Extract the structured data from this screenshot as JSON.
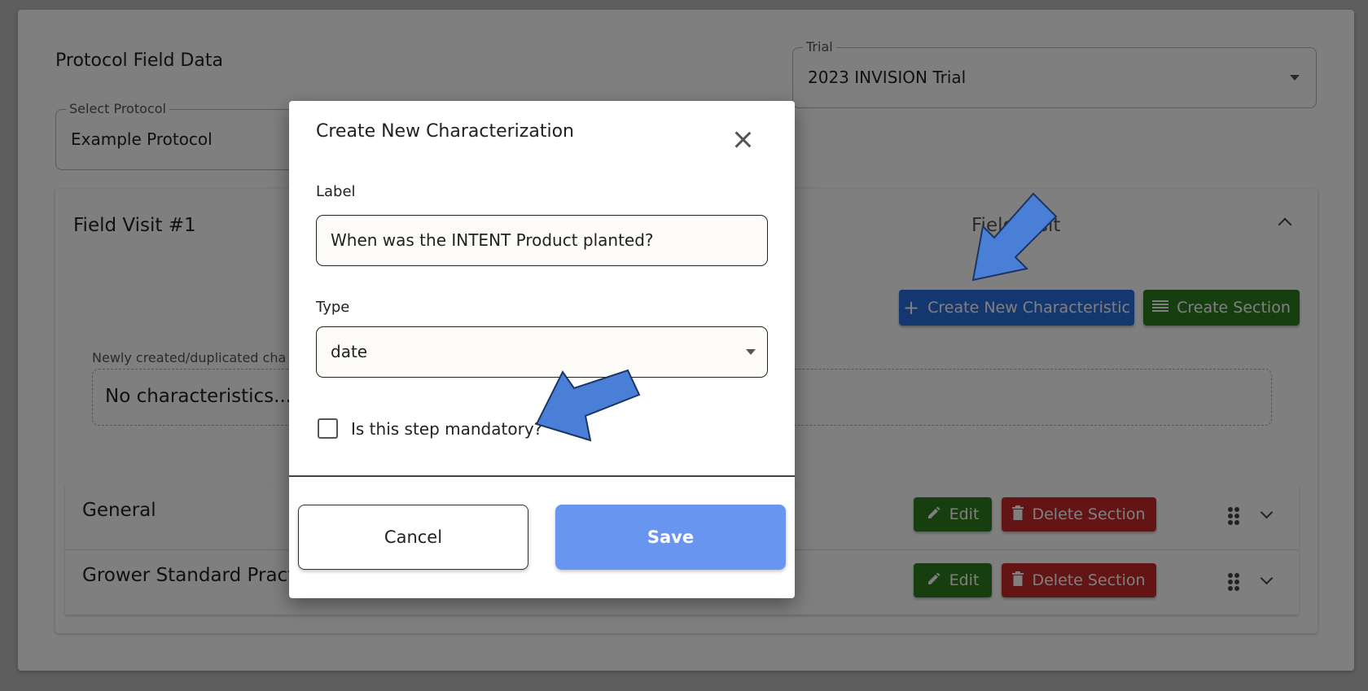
{
  "page": {
    "title": "Protocol Field Data"
  },
  "trial_select": {
    "legend": "Trial",
    "value": "2023 INVISION Trial"
  },
  "protocol_select": {
    "legend": "Select Protocol",
    "value": "Example Protocol"
  },
  "field_visit": {
    "title": "Field Visit #1",
    "center_text": "Field Visit",
    "create_characteristic_label": "Create New Characteristic",
    "create_section_label": "Create Section",
    "new_characteristics_label": "Newly created/duplicated cha",
    "empty_text": "No characteristics..."
  },
  "sections": [
    {
      "name": "General",
      "edit_label": "Edit",
      "delete_label": "Delete Section"
    },
    {
      "name": "Grower Standard Practic",
      "edit_label": "Edit",
      "delete_label": "Delete Section"
    }
  ],
  "modal": {
    "title": "Create New Characterization",
    "label_field": {
      "label": "Label",
      "value": "When was the INTENT Product planted?"
    },
    "type_field": {
      "label": "Type",
      "value": "date"
    },
    "mandatory_checkbox": {
      "label": "Is this step mandatory?",
      "checked": false
    },
    "cancel_label": "Cancel",
    "save_label": "Save"
  },
  "icons": {
    "plus": "plus-icon",
    "section": "list-lines-icon",
    "edit": "pencil-icon",
    "delete": "trash-icon",
    "drag": "drag-handle-icon",
    "close": "close-icon"
  },
  "colors": {
    "primary_blue": "#2b6fe0",
    "save_blue": "#6795ef",
    "green": "#2e7d1f",
    "red": "#c62828",
    "annotation_arrow": "#4a7fd8"
  }
}
